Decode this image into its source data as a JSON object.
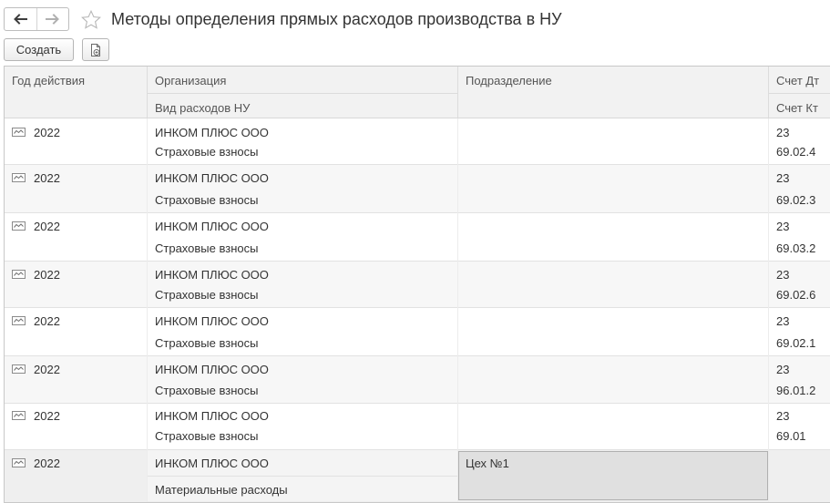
{
  "window": {
    "title": "Методы определения прямых расходов производства в НУ"
  },
  "toolbar": {
    "create_label": "Создать"
  },
  "table": {
    "headers": {
      "year": "Год действия",
      "organization": "Организация",
      "expense_kind": "Вид расходов НУ",
      "department": "Подразделение",
      "account_dt": "Счет Дт",
      "account_kt": "Счет Кт"
    },
    "rows": [
      {
        "year": "2022",
        "organization": "ИНКОМ ПЛЮС ООО",
        "expense_kind": "Страховые взносы",
        "department": "",
        "account_dt": "23",
        "account_kt": "69.02.4"
      },
      {
        "year": "2022",
        "organization": "ИНКОМ ПЛЮС ООО",
        "expense_kind": "Страховые взносы",
        "department": "",
        "account_dt": "23",
        "account_kt": "69.02.3"
      },
      {
        "year": "2022",
        "organization": "ИНКОМ ПЛЮС ООО",
        "expense_kind": "Страховые взносы",
        "department": "",
        "account_dt": "23",
        "account_kt": "69.03.2"
      },
      {
        "year": "2022",
        "organization": "ИНКОМ ПЛЮС ООО",
        "expense_kind": "Страховые взносы",
        "department": "",
        "account_dt": "23",
        "account_kt": "69.02.6"
      },
      {
        "year": "2022",
        "organization": "ИНКОМ ПЛЮС ООО",
        "expense_kind": "Страховые взносы",
        "department": "",
        "account_dt": "23",
        "account_kt": "69.02.1"
      },
      {
        "year": "2022",
        "organization": "ИНКОМ ПЛЮС ООО",
        "expense_kind": "Страховые взносы",
        "department": "",
        "account_dt": "23",
        "account_kt": "96.01.2"
      },
      {
        "year": "2022",
        "organization": "ИНКОМ ПЛЮС ООО",
        "expense_kind": "Страховые взносы",
        "department": "",
        "account_dt": "23",
        "account_kt": "69.01"
      },
      {
        "year": "2022",
        "organization": "ИНКОМ ПЛЮС ООО",
        "expense_kind": "Материальные расходы",
        "department": "Цех №1",
        "account_dt": "",
        "account_kt": ""
      }
    ]
  }
}
